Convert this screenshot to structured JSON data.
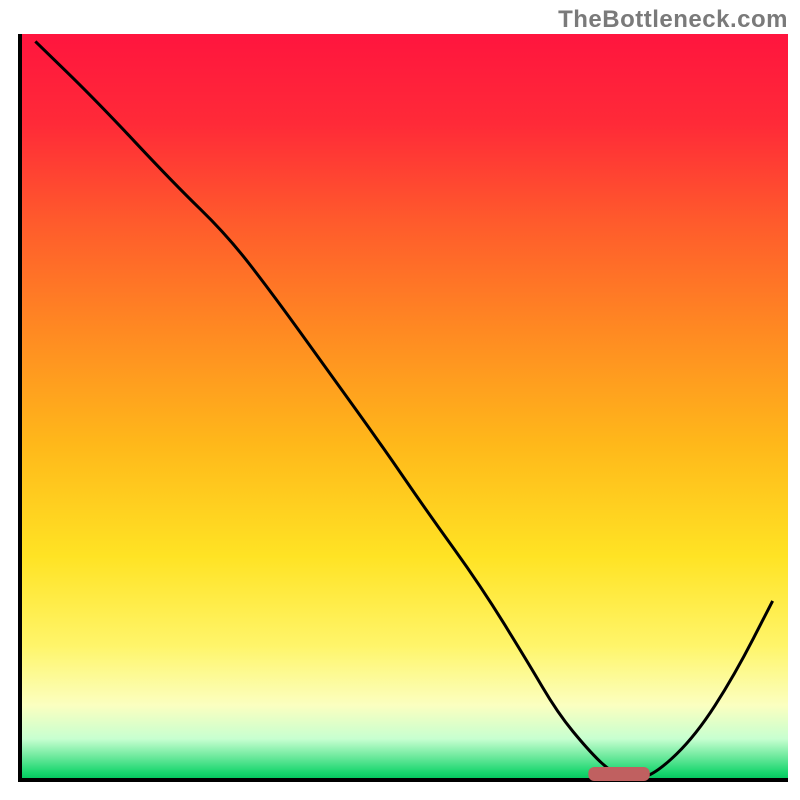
{
  "watermark": "TheBottleneck.com",
  "chart_data": {
    "type": "line",
    "title": "",
    "xlabel": "",
    "ylabel": "",
    "xlim": [
      0,
      100
    ],
    "ylim": [
      0,
      100
    ],
    "grid": false,
    "legend": false,
    "x": [
      2,
      10,
      20,
      27,
      33,
      40,
      47,
      53,
      60,
      66,
      70,
      74,
      77,
      80,
      83,
      88,
      93,
      98
    ],
    "values": [
      99,
      91,
      80,
      73,
      65,
      55,
      45,
      36,
      26,
      16,
      9,
      4,
      1,
      0,
      1,
      6,
      14,
      24
    ],
    "gradient_stops": [
      {
        "offset": 0.0,
        "color": "#ff153e"
      },
      {
        "offset": 0.12,
        "color": "#ff2a38"
      },
      {
        "offset": 0.25,
        "color": "#ff5a2c"
      },
      {
        "offset": 0.4,
        "color": "#ff8a22"
      },
      {
        "offset": 0.55,
        "color": "#ffb81a"
      },
      {
        "offset": 0.7,
        "color": "#ffe324"
      },
      {
        "offset": 0.82,
        "color": "#fff56a"
      },
      {
        "offset": 0.9,
        "color": "#fbffc0"
      },
      {
        "offset": 0.945,
        "color": "#c7ffd0"
      },
      {
        "offset": 0.97,
        "color": "#68e89a"
      },
      {
        "offset": 0.99,
        "color": "#18d66e"
      },
      {
        "offset": 1.0,
        "color": "#00c45c"
      }
    ],
    "marker": {
      "x": 78,
      "width": 8,
      "y": 0.8,
      "color": "#c06060"
    },
    "axis_color": "#000000",
    "line_color": "#000000"
  }
}
